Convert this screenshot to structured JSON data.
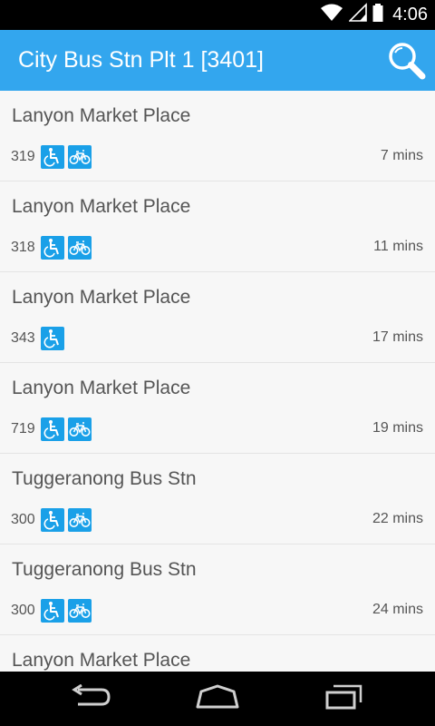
{
  "status_bar": {
    "time": "4:06",
    "icons": [
      "wifi-icon",
      "signal-icon",
      "battery-icon"
    ]
  },
  "app_bar": {
    "title": "City Bus Stn Plt 1 [3401]",
    "search_icon": "search-icon",
    "background": "#33a6ee"
  },
  "departures": [
    {
      "destination": "Lanyon Market Place",
      "route": "319",
      "wheelchair": true,
      "bike": true,
      "eta": "7 mins"
    },
    {
      "destination": "Lanyon Market Place",
      "route": "318",
      "wheelchair": true,
      "bike": true,
      "eta": "11 mins"
    },
    {
      "destination": "Lanyon Market Place",
      "route": "343",
      "wheelchair": true,
      "bike": false,
      "eta": "17 mins"
    },
    {
      "destination": "Lanyon Market Place",
      "route": "719",
      "wheelchair": true,
      "bike": true,
      "eta": "19 mins"
    },
    {
      "destination": "Tuggeranong Bus Stn",
      "route": "300",
      "wheelchair": true,
      "bike": true,
      "eta": "22 mins"
    },
    {
      "destination": "Tuggeranong Bus Stn",
      "route": "300",
      "wheelchair": true,
      "bike": true,
      "eta": "24 mins"
    },
    {
      "destination": "Lanyon Market Place",
      "route": "",
      "wheelchair": false,
      "bike": false,
      "eta": ""
    }
  ],
  "badge_color": "#1aa0e8",
  "nav_bar": {
    "buttons": [
      "back-icon",
      "home-icon",
      "recents-icon"
    ]
  }
}
